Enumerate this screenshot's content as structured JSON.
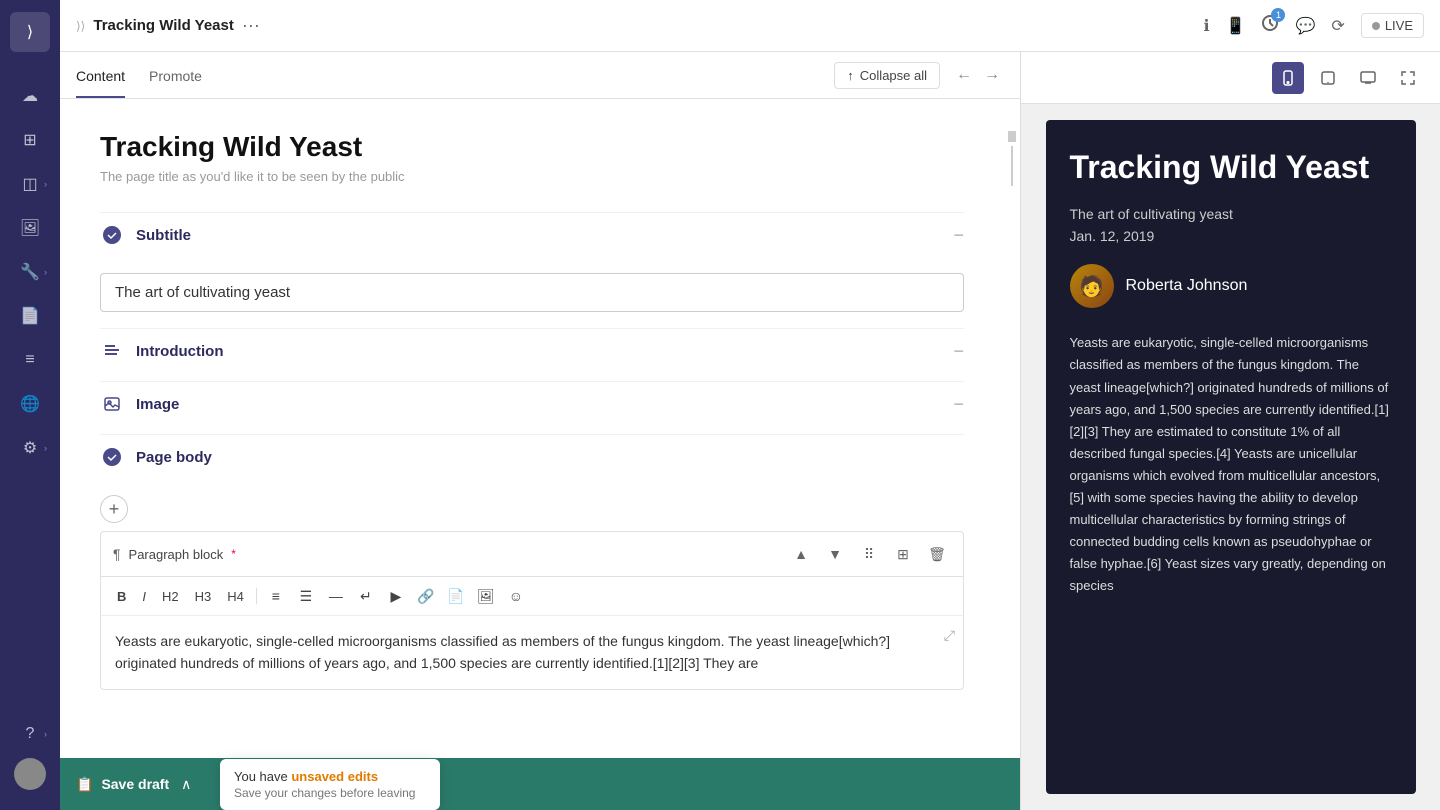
{
  "topbar": {
    "breadcrumb_arrow": "⟩⟩",
    "page_title": "Tracking Wild Yeast",
    "menu_dots": "···",
    "live_label": "LIVE"
  },
  "tabs": {
    "content": "Content",
    "promote": "Promote",
    "active": "content"
  },
  "toolbar": {
    "collapse_all": "Collapse all",
    "save_draft": "Save draft",
    "save_chevron": "∧"
  },
  "editor": {
    "page_title": "Tracking Wild Yeast",
    "page_title_hint": "The page title as you'd like it to be seen by the public",
    "subtitle_label": "Subtitle",
    "subtitle_value": "The art of cultivating yeast",
    "introduction_label": "Introduction",
    "image_label": "Image",
    "page_body_label": "Page body",
    "paragraph_block_label": "Paragraph block",
    "required_marker": "*",
    "paragraph_text": "Yeasts are eukaryotic, single-celled microorganisms classified as members of the fungus kingdom. The yeast lineage[which?] originated hundreds of millions of years ago, and 1,500 species are currently identified.[1][2][3] They are"
  },
  "unsaved": {
    "title_prefix": "You have ",
    "highlight": "unsaved edits",
    "description": "Save your changes before leaving"
  },
  "preview": {
    "title": "Tracking Wild Yeast",
    "subtitle": "The art of cultivating yeast",
    "date": "Jan. 12, 2019",
    "author_name": "Roberta Johnson",
    "author_emoji": "👩",
    "body_text": "Yeasts are eukaryotic, single-celled microorganisms classified as members of the fungus kingdom. The yeast lineage[which?] originated hundreds of millions of years ago, and 1,500 species are currently identified.[1][2][3] They are estimated to constitute 1% of all described fungal species.[4] Yeasts are unicellular organisms which evolved from multicellular ancestors,[5] with some species having the ability to develop multicellular characteristics by forming strings of connected budding cells known as pseudohyphae or false hyphae.[6] Yeast sizes vary greatly, depending on species"
  },
  "sidebar": {
    "icons": [
      "≫",
      "☁",
      "⊞",
      "◫",
      "⊞",
      "✎",
      "☁",
      "⊕",
      "?"
    ]
  },
  "icons": {
    "info": "ℹ",
    "mobile": "📱",
    "share": "↗",
    "chat": "💬",
    "history": "⟳",
    "collapse_arrow": "↑",
    "arrow_left": "←",
    "arrow_right": "→",
    "phone_view": "📱",
    "tablet_view": "⬜",
    "desktop_view": "🖥",
    "expand_view": "⤢",
    "badge_count": "1"
  }
}
